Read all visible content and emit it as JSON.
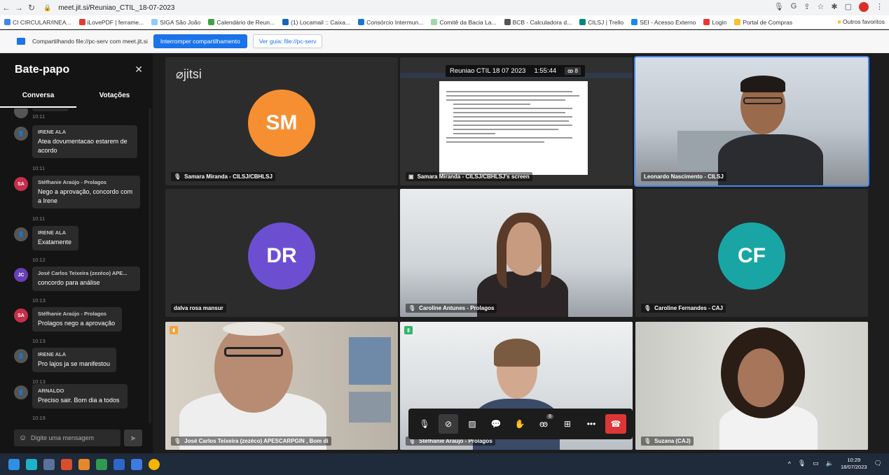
{
  "browser": {
    "url": "meet.jit.si/Reuniao_CTIL_18-07-2023",
    "bookmarks": [
      "CI CIRCULAR/INEA...",
      "iLovePDF | ferrame...",
      "SIGA São João",
      "Calendário de Reun...",
      "(1) Locamail :: Caixa...",
      "Consórcio Intermun...",
      "Comitê da Bacia La...",
      "BCB - Calculadora d...",
      "CILSJ | Trello",
      "SEI - Acesso Externo",
      "Login",
      "Portal de Compras"
    ],
    "bookmark_colors": [
      "#4285f4",
      "#e53935",
      "#90caf9",
      "#43a047",
      "#1565c0",
      "#1976d2",
      "#a5d6a7",
      "#555555",
      "#00897b",
      "#1e88e5",
      "#e53935",
      "#fbc02d"
    ],
    "other_bookmarks": "Outros favoritos"
  },
  "share_bar": {
    "text": "Compartilhando file://pc-serv com meet.jit.si",
    "stop_label": "Interromper compartilhamento",
    "view_label": "Ver guia: file://pc-serv"
  },
  "chat": {
    "title": "Bate-papo",
    "tabs": [
      "Conversa",
      "Votações"
    ],
    "input_placeholder": "Digite uma mensagem",
    "messages": [
      {
        "time": "10:11"
      },
      {
        "name": "IRENE ALA",
        "text": "Atea dovumentacao estarem de acordo",
        "time": "10:11",
        "avatar": "",
        "avatar_color": "#555555"
      },
      {
        "name": "Stéfhanie Araújo - Prolagos",
        "text": "Nego a aprovação, concordo com a Irene",
        "time": "10:11",
        "avatar": "SA",
        "avatar_color": "#c62e4a"
      },
      {
        "name": "IRENE ALA",
        "text": "Exatamente",
        "time": "10:12",
        "avatar": "",
        "avatar_color": "#555555"
      },
      {
        "name": "José Carlos Teixeira (zezéco) APE...",
        "text": "concordo para análise",
        "time": "10:13",
        "avatar": "JC",
        "avatar_color": "#6a3fb5"
      },
      {
        "name": "Stéfhanie Araújo - Prolagos",
        "text": "Prolagos nego a aprovação",
        "time": "10:13",
        "avatar": "SA",
        "avatar_color": "#c62e4a"
      },
      {
        "name": "IRENE ALA",
        "text": "Pro lajos ja se manifestou",
        "time": "10:13",
        "avatar": "",
        "avatar_color": "#555555"
      },
      {
        "name": "ARNALDO",
        "text": "Preciso sair. Bom dia a todos",
        "time": "10:19",
        "avatar": "",
        "avatar_color": "#555555"
      }
    ]
  },
  "meeting": {
    "title": "Reuniao CTIL 18 07 2023",
    "duration": "1:55:44",
    "participant_count": "8",
    "logo": "jitsi"
  },
  "tiles": [
    {
      "label": "Samara Miranda - CILSJ/CBHLSJ",
      "initials": "SM",
      "color": "#f58f32"
    },
    {
      "label": "Samara Miranda - CILSJ/CBHLSJ's screen"
    },
    {
      "label": "Leonardo Nascimento - CILSJ"
    },
    {
      "label": "dalva rosa mansur",
      "initials": "DR",
      "color": "#6c4fd1"
    },
    {
      "label": "Caroline Antunes - Prolagos"
    },
    {
      "label": "Caroline Fernandes - CAJ",
      "initials": "CF",
      "color": "#1aa5a5"
    },
    {
      "label": "José Carlos Teixeira (zezéco) APESCARPGIN , Bom di"
    },
    {
      "label": "Stéfhanie Araújo - Prolagos"
    },
    {
      "label": "Suzana (CAJ)"
    }
  ],
  "toolbar": {
    "badge": "8"
  },
  "taskbar": {
    "time": "10:29",
    "date": "18/07/2023"
  }
}
